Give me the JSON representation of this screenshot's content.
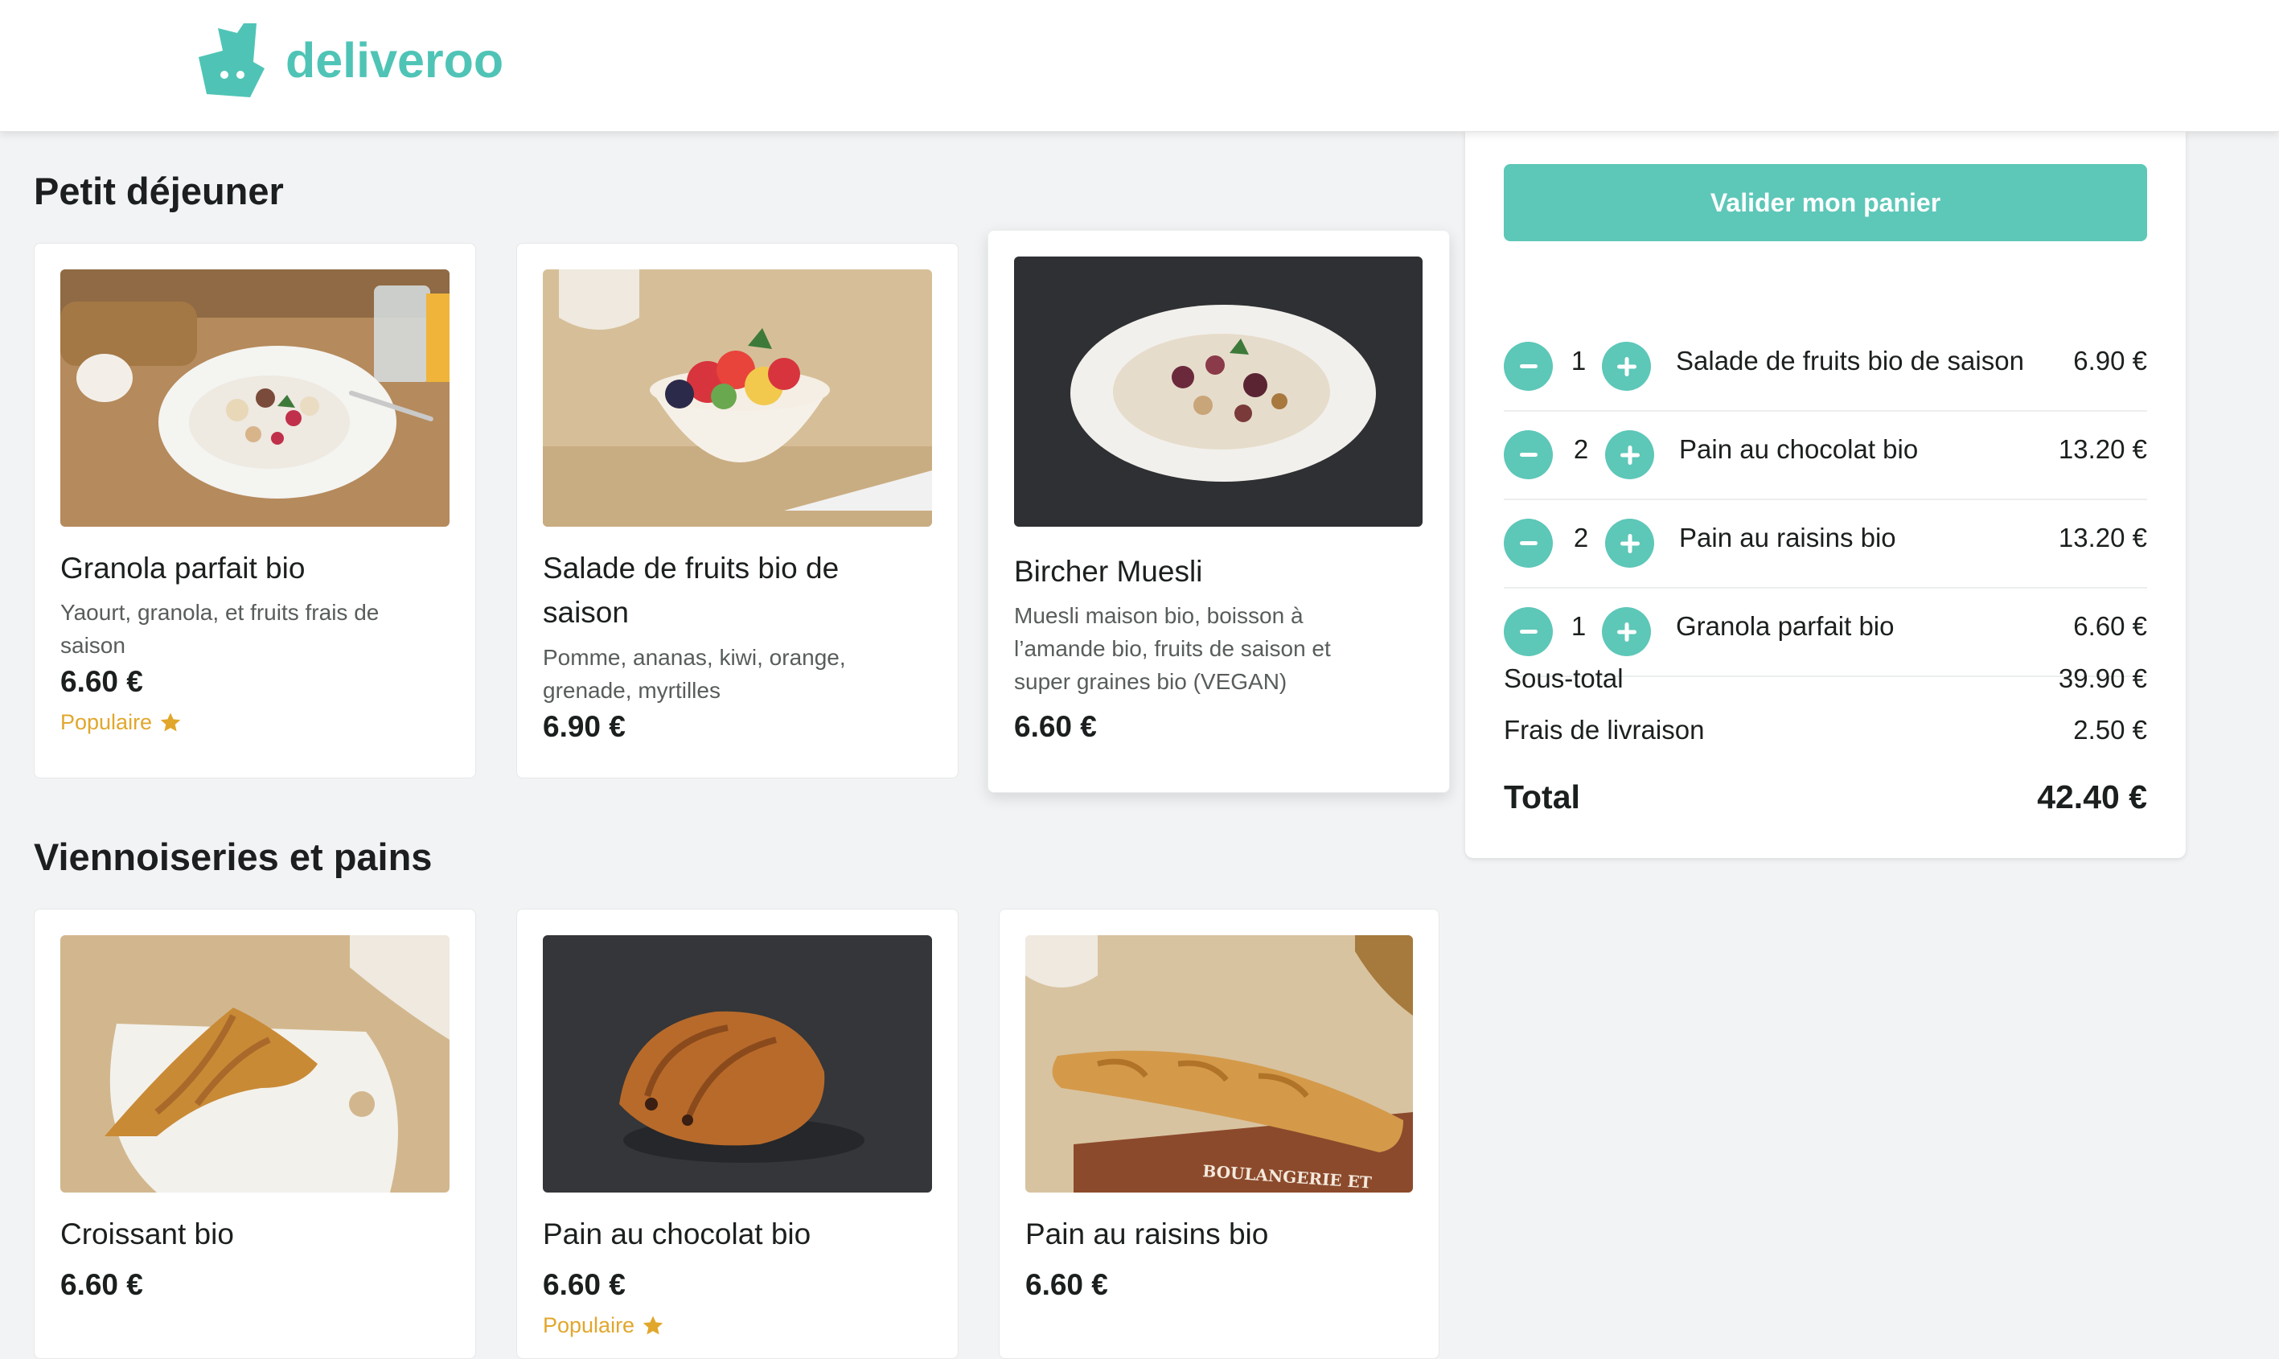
{
  "brand": {
    "name": "deliveroo",
    "color": "#4fc4b6"
  },
  "sections": [
    {
      "title": "Petit déjeuner",
      "items": [
        {
          "name": "Granola parfait bio",
          "description": "Yaourt, granola, et fruits frais de saison",
          "price": "6.60 €",
          "badge": "Populaire"
        },
        {
          "name": "Salade de fruits bio de saison",
          "description": "Pomme, ananas, kiwi, orange, grenade, myrtilles",
          "price": "6.90 €"
        },
        {
          "name": "Bircher Muesli",
          "description": "Muesli maison bio, boisson à l’amande bio, fruits de saison et super graines bio (VEGAN)",
          "price": "6.60 €"
        }
      ]
    },
    {
      "title": "Viennoiseries et pains",
      "items": [
        {
          "name": "Croissant bio",
          "price": "6.60 €"
        },
        {
          "name": "Pain au chocolat bio",
          "price": "6.60 €",
          "badge": "Populaire"
        },
        {
          "name": "Pain au raisins bio",
          "price": "6.60 €",
          "image_text": "BOULANGERIE ET"
        }
      ]
    }
  ],
  "basket": {
    "checkout_label": "Valider mon panier",
    "items": [
      {
        "qty": "1",
        "name": "Salade de fruits bio de saison",
        "price": "6.90 €"
      },
      {
        "qty": "2",
        "name": "Pain au chocolat bio",
        "price": "13.20 €"
      },
      {
        "qty": "2",
        "name": "Pain au raisins bio",
        "price": "13.20 €"
      },
      {
        "qty": "1",
        "name": "Granola parfait bio",
        "price": "6.60 €"
      }
    ],
    "subtotal_label": "Sous-total",
    "subtotal": "39.90 €",
    "delivery_label": "Frais de livraison",
    "delivery": "2.50 €",
    "total_label": "Total",
    "total": "42.40 €"
  },
  "colors": {
    "accent": "#5dc7b8",
    "popular": "#e1a72c"
  }
}
